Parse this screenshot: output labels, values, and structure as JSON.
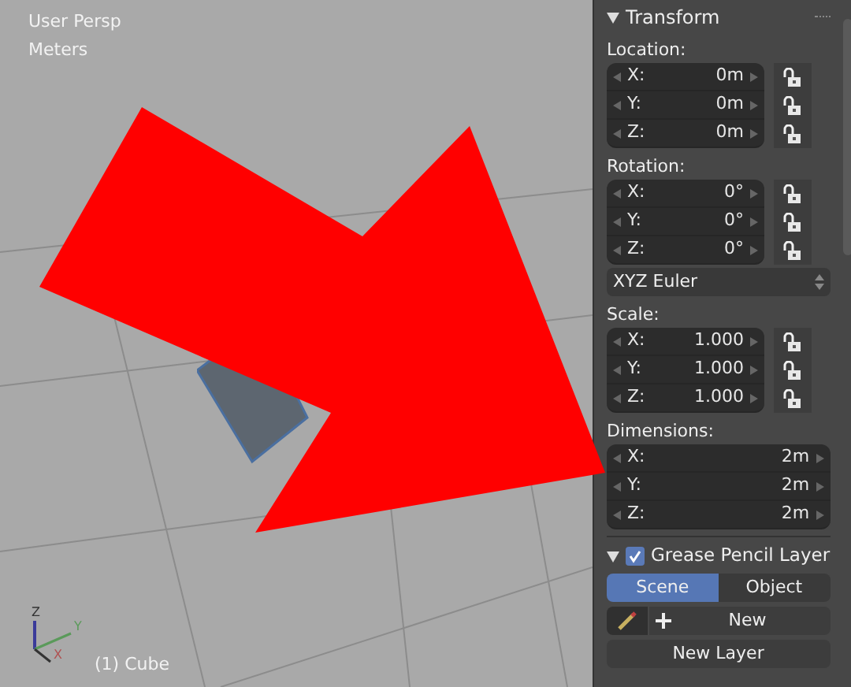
{
  "viewport": {
    "view_name": "User Persp",
    "units": "Meters",
    "object_label": "(1) Cube",
    "gizmo": {
      "z": "Z",
      "y": "Y",
      "x": "X"
    }
  },
  "properties": {
    "transform": {
      "title": "Transform",
      "expanded": true,
      "groups": [
        {
          "label": "Location:",
          "kind": "lockable",
          "rows": [
            {
              "axis": "X:",
              "value": "0m",
              "locked": false
            },
            {
              "axis": "Y:",
              "value": "0m",
              "locked": false
            },
            {
              "axis": "Z:",
              "value": "0m",
              "locked": false
            }
          ]
        },
        {
          "label": "Rotation:",
          "kind": "lockable",
          "rows": [
            {
              "axis": "X:",
              "value": "0°",
              "locked": false
            },
            {
              "axis": "Y:",
              "value": "0°",
              "locked": false
            },
            {
              "axis": "Z:",
              "value": "0°",
              "locked": false
            }
          ]
        },
        {
          "label": "XYZ Euler",
          "kind": "dropdown"
        },
        {
          "label": "Scale:",
          "kind": "lockable",
          "rows": [
            {
              "axis": "X:",
              "value": "1.000",
              "locked": false
            },
            {
              "axis": "Y:",
              "value": "1.000",
              "locked": false
            },
            {
              "axis": "Z:",
              "value": "1.000",
              "locked": false
            }
          ]
        },
        {
          "label": "Dimensions:",
          "kind": "plain",
          "rows": [
            {
              "axis": "X:",
              "value": "2m"
            },
            {
              "axis": "Y:",
              "value": "2m"
            },
            {
              "axis": "Z:",
              "value": "2m"
            }
          ]
        }
      ]
    },
    "grease_pencil": {
      "title": "Grease Pencil Layer",
      "expanded": true,
      "checked": true,
      "tabs": [
        {
          "label": "Scene",
          "selected": true
        },
        {
          "label": "Object",
          "selected": false
        }
      ],
      "new_button": "New",
      "new_layer_button": "New Layer"
    }
  }
}
